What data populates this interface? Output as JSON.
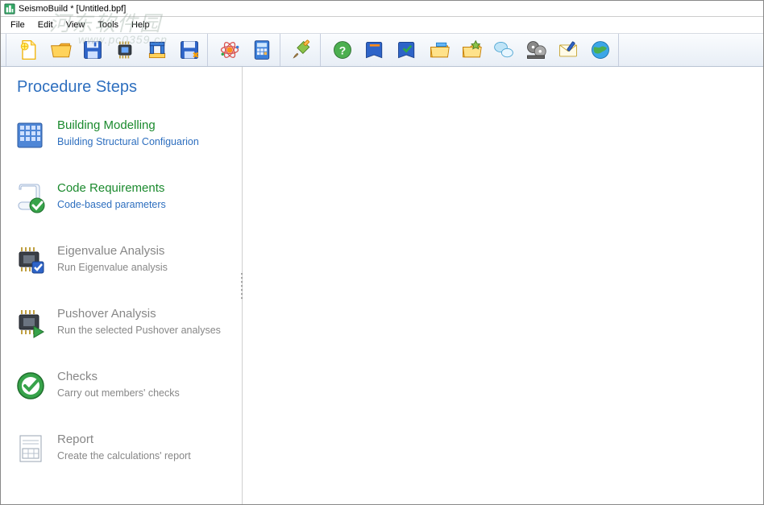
{
  "title": "SeismoBuild * [Untitled.bpf]",
  "menu": {
    "file": "File",
    "edit": "Edit",
    "view": "View",
    "tools": "Tools",
    "help": "Help"
  },
  "watermark": {
    "line1": "河东软件园",
    "line2": "www.pc0359.cn"
  },
  "sidebar": {
    "header": "Procedure Steps",
    "steps": [
      {
        "title": "Building Modelling",
        "sub": "Building Structural Configuarion"
      },
      {
        "title": "Code Requirements",
        "sub": "Code-based parameters"
      },
      {
        "title": "Eigenvalue Analysis",
        "sub": "Run Eigenvalue analysis"
      },
      {
        "title": "Pushover Analysis",
        "sub": "Run the selected Pushover analyses"
      },
      {
        "title": "Checks",
        "sub": "Carry out members' checks"
      },
      {
        "title": "Report",
        "sub": "Create the calculations' report"
      }
    ]
  },
  "toolbar": {
    "icons": [
      "new-file-icon",
      "open-folder-icon",
      "save-disk-icon",
      "chip-icon",
      "structure-icon",
      "save-as-icon",
      "analyze-atom-icon",
      "calculator-icon",
      "paint-brush-icon",
      "help-icon",
      "book-blue-icon",
      "book-check-icon",
      "folder-stack-icon",
      "folder-star-icon",
      "chat-bubbles-icon",
      "film-reel-icon",
      "mail-pen-icon",
      "globe-icon"
    ]
  }
}
